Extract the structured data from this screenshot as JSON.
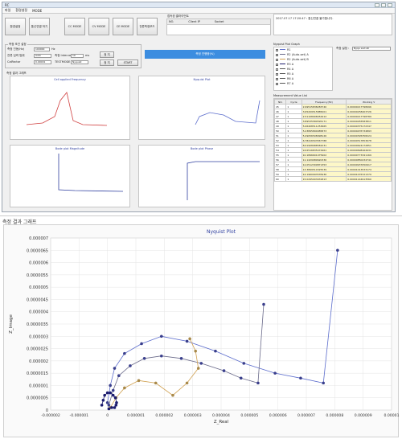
{
  "window": {
    "title": "RC",
    "menu": [
      "파일",
      "환경설정",
      "MODE"
    ]
  },
  "toolbar": [
    "환경설정",
    "통신연결 하기",
    "CC MODE",
    "CV MODE",
    "CE MODE",
    "전류측정모드"
  ],
  "log": {
    "columns": [
      "NO.",
      "Client IP",
      "Socket"
    ],
    "message": "2017.07.17 17:20:47 : 통신연결 불가합니다.",
    "label": "접속된 클라이언트"
  },
  "settings": {
    "group_title": "측정 조건 설정",
    "rows": [
      {
        "label": "측정 진동(Hz)",
        "value": "100000",
        "unit": "Hz"
      },
      {
        "label": "전류 입력 범위",
        "value": "Auto"
      },
      {
        "label": "CalFactor",
        "value": "0.00001"
      }
    ],
    "interval_label": "측정 Interval",
    "interval_value": "10",
    "interval_unit": "ms",
    "testmode_label": "TESTMODE",
    "testmode_value": "Nyquist",
    "stop_button": "정 지",
    "start_button": "START",
    "status_bar": "측정 진행중(%)"
  },
  "charts": {
    "group_title": "측정 결과 그래프",
    "titles": [
      "Cell applied Frequency",
      "Nyquist Plot",
      "Bode plot Magnitude",
      "Bode plot Phase"
    ]
  },
  "plot_list": {
    "title": "Nyquist Plot Graph",
    "items": [
      "R1",
      "R2 (Auto-set) A",
      "R2 (Auto-set) B",
      "R3 A",
      "R4 A",
      "R5 A",
      "R6 A",
      "R7 A"
    ],
    "options_label": "측정 설정 :",
    "options_value": "Nyqu and All"
  },
  "table": {
    "title": "Measurement Value List",
    "columns": [
      "NO.",
      "Cycle",
      "Frequency(Hz)",
      "Working V"
    ],
    "rows": [
      [
        "45",
        "1",
        "2.99515838283740",
        "0.00000217798996"
      ],
      [
        "46",
        "1",
        "3.65209515885001",
        "0.00000258403726"
      ],
      [
        "47",
        "1",
        "2.51108908452912",
        "0.00000217798789"
      ],
      [
        "48",
        "1",
        "3.89535580595171",
        "0.00000283583811"
      ],
      [
        "49",
        "1",
        "5.06408511253665",
        "0.00000375172347"
      ],
      [
        "50",
        "1",
        "5.23895890085873",
        "0.00000435734893"
      ],
      [
        "51",
        "1",
        "5.09056508998126",
        "0.00000395358224"
      ],
      [
        "52",
        "1",
        "6.78416503567788",
        "0.00000517853678"
      ],
      [
        "53",
        "1",
        "8.01908988581031",
        "0.00000624172851"
      ],
      [
        "54",
        "1",
        "9.02516835472961",
        "0.00000698164931"
      ],
      [
        "55",
        "1",
        "10.1896601075902",
        "0.00000773341169"
      ],
      [
        "56",
        "1",
        "11.1429989620336",
        "0.00000850234741"
      ],
      [
        "57",
        "1",
        "12.0512309871353",
        "0.00000937050917"
      ],
      [
        "58",
        "1",
        "13.3899510325539",
        "0.00001013533174"
      ],
      [
        "59",
        "1",
        "14.1960993535936",
        "0.00001076721379"
      ],
      [
        "60",
        "1",
        "15.0295003931813",
        "0.00001144913560"
      ]
    ]
  },
  "detail": {
    "section_title": "측정 결과 그래프",
    "chart_data": {
      "type": "line",
      "title": "Nyquist Plot",
      "xlabel": "Z_Real",
      "ylabel": "Z_Image",
      "xlim": [
        -2e-06,
        1e-05
      ],
      "ylim": [
        0,
        7e-06
      ],
      "xticks": [
        "-0.000002",
        "-0.000001",
        "0",
        "0.000001",
        "0.000002",
        "0.000003",
        "0.000004",
        "0.000005",
        "0.000006",
        "0.000007",
        "0.000008",
        "0.000009",
        "0.00001"
      ],
      "yticks": [
        "0",
        "0.0000005",
        "0.000001",
        "0.0000015",
        "0.000002",
        "0.0000025",
        "0.000003",
        "0.0000035",
        "0.000004",
        "0.0000045",
        "0.000005",
        "0.0000055",
        "0.000006",
        "0.0000065",
        "0.000007"
      ],
      "grid": true,
      "series": [
        {
          "color": "#5b6ccc",
          "x": [
            0,
            1e-07,
            2.5e-07,
            6e-07,
            1.2e-06,
            1.9e-06,
            2.8e-06,
            3.8e-06,
            4.8e-06,
            5.9e-06,
            6.8e-06,
            7.6e-06,
            8.1e-06
          ],
          "y": [
            3e-07,
            1e-06,
            1.7e-06,
            2.3e-06,
            2.7e-06,
            3e-06,
            2.8e-06,
            2.4e-06,
            1.9e-06,
            1.5e-06,
            1.3e-06,
            1.1e-06,
            6.5e-06
          ]
        },
        {
          "color": "#6a6a8a",
          "x": [
            5e-08,
            2e-07,
            4e-07,
            8e-07,
            1.3e-06,
            1.9e-06,
            2.6e-06,
            3.3e-06,
            4.1e-06,
            4.7e-06,
            5.3e-06,
            5.5e-06
          ],
          "y": [
            2e-07,
            8e-07,
            1.4e-06,
            1.8e-06,
            2.1e-06,
            2.2e-06,
            2.1e-06,
            1.9e-06,
            1.6e-06,
            1.3e-06,
            1.1e-06,
            4.3e-06
          ]
        },
        {
          "color": "#d0a050",
          "x": [
            1e-07,
            3e-07,
            6e-07,
            1.1e-06,
            1.7e-06,
            2.3e-06,
            2.8e-06,
            3.2e-06,
            3.1e-06,
            2.9e-06
          ],
          "y": [
            1e-07,
            5e-07,
            9e-07,
            1.2e-06,
            1.1e-06,
            6e-07,
            1.1e-06,
            1.7e-06,
            2.4e-06,
            2.9e-06
          ]
        },
        {
          "color": "#1c1c6e",
          "x": [
            -2e-07,
            -1.5e-07,
            -1e-07,
            0,
            1e-07,
            2e-07,
            2.8e-07,
            3.2e-07,
            3e-07,
            2.5e-07,
            1.5e-07,
            5e-08
          ],
          "y": [
            2e-07,
            4e-07,
            6e-07,
            7e-07,
            7e-07,
            6e-07,
            5e-07,
            3e-07,
            2e-07,
            1e-07,
            1e-07,
            5e-08
          ]
        }
      ]
    }
  }
}
